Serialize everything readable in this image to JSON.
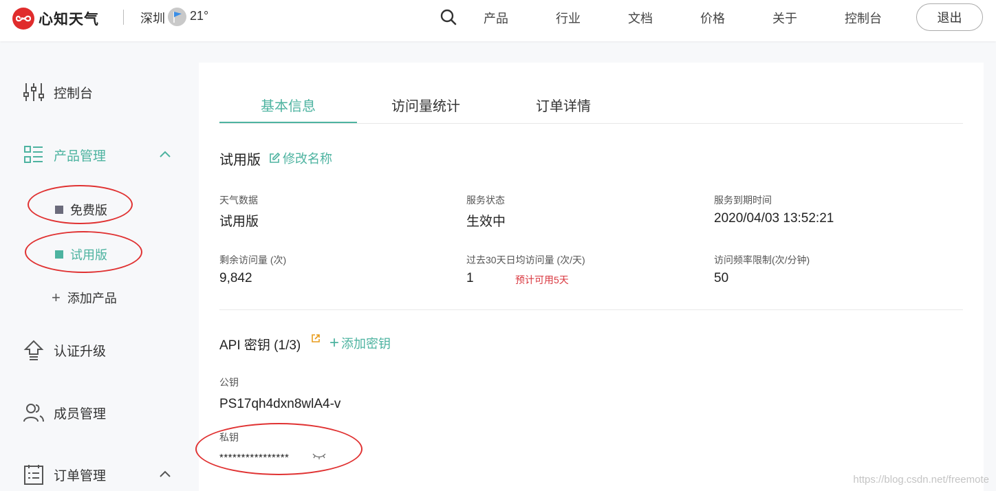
{
  "brand": {
    "name": "心知天气",
    "accent": "#4db3a0",
    "logo_color": "#e02c2c"
  },
  "header": {
    "city": "深圳",
    "temperature": "21°",
    "nav": [
      "产品",
      "行业",
      "文档",
      "价格",
      "关于",
      "控制台"
    ],
    "logout": "退出"
  },
  "sidebar": {
    "console": "控制台",
    "product_mgmt": "产品管理",
    "products": [
      {
        "label": "免费版",
        "color": "#6b6b7b"
      },
      {
        "label": "试用版",
        "color": "#4db3a0"
      }
    ],
    "add_product": "添加产品",
    "cert_upgrade": "认证升级",
    "member_mgmt": "成员管理",
    "order_mgmt": "订单管理"
  },
  "tabs": [
    "基本信息",
    "访问量统计",
    "订单详情"
  ],
  "product": {
    "name": "试用版",
    "rename": "修改名称",
    "fields": [
      {
        "label": "天气数据",
        "value": "试用版"
      },
      {
        "label": "服务状态",
        "value": "生效中"
      },
      {
        "label": "服务到期时间",
        "value": "2020/04/03 13:52:21"
      },
      {
        "label": "剩余访问量 (次)",
        "value": "9,842"
      },
      {
        "label": "过去30天日均访问量 (次/天)",
        "value": "1",
        "note": "预计可用5天"
      },
      {
        "label": "访问频率限制(次/分钟)",
        "value": "50"
      }
    ]
  },
  "api": {
    "title": "API 密钥 (1/3)",
    "add_key": "添加密钥",
    "public_label": "公钥",
    "public_key": "PS17qh4dxn8wlA4-v",
    "private_label": "私钥",
    "private_key": "****************"
  },
  "watermark": "https://blog.csdn.net/freemote"
}
